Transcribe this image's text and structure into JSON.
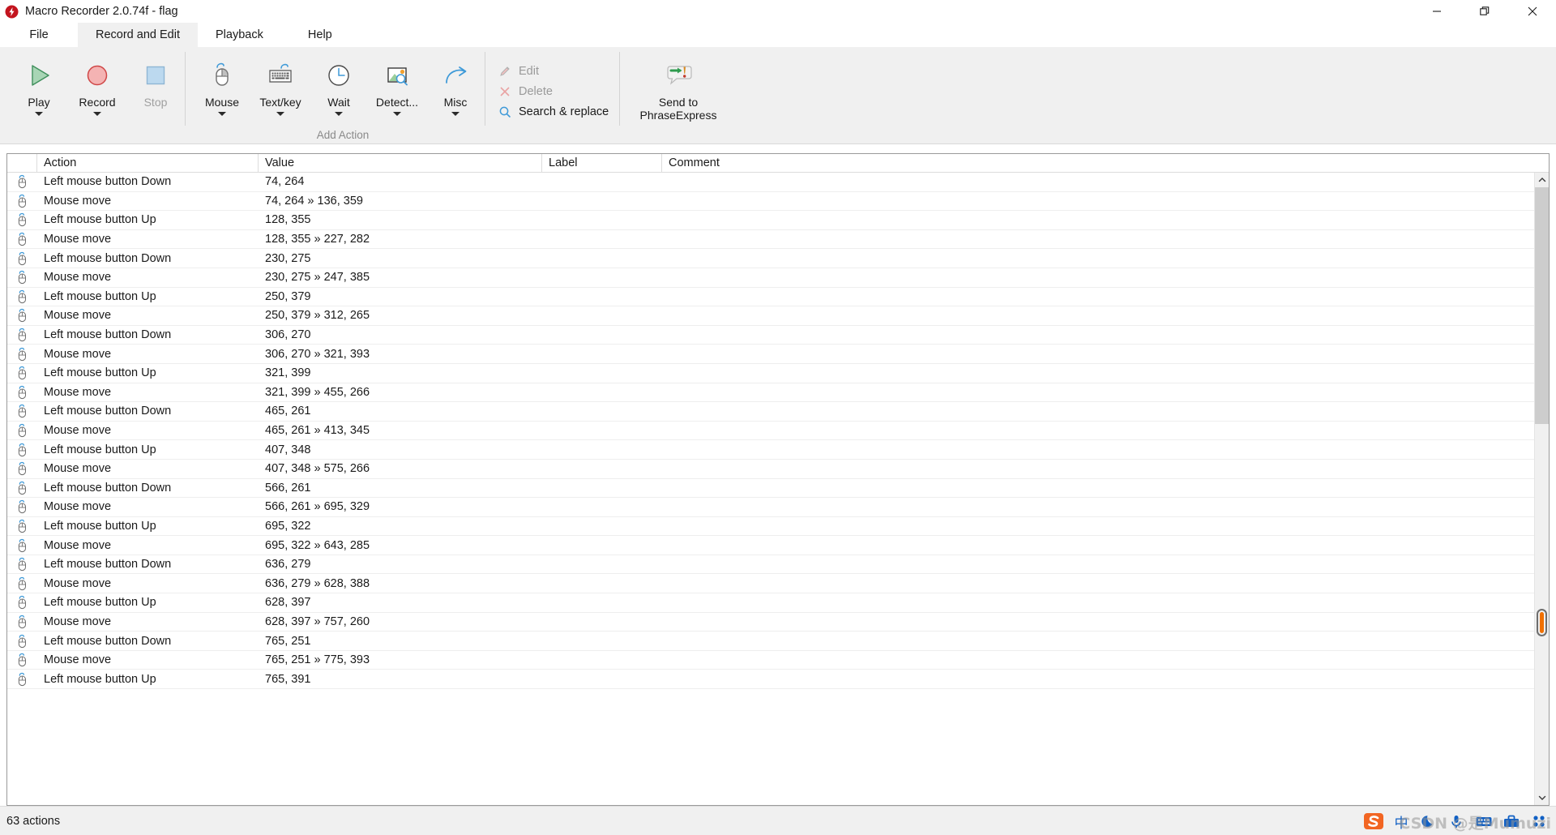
{
  "window": {
    "title": "Macro Recorder 2.0.74f - flag",
    "logo_icon": "lightning-bolt-icon",
    "controls": [
      {
        "name": "minimize-button",
        "icon": "minimize-icon"
      },
      {
        "name": "maximize-button",
        "icon": "restore-icon"
      },
      {
        "name": "close-button",
        "icon": "close-icon"
      }
    ]
  },
  "tabs": [
    {
      "label": "File",
      "active": false
    },
    {
      "label": "Record and Edit",
      "active": true
    },
    {
      "label": "Playback",
      "active": false
    },
    {
      "label": "Help",
      "active": false
    }
  ],
  "ribbon": {
    "group_playback": {
      "buttons": [
        {
          "label": "Play",
          "icon": "play-triangle-icon",
          "caret": true,
          "disabled": false
        },
        {
          "label": "Record",
          "icon": "record-circle-icon",
          "caret": true,
          "disabled": false
        },
        {
          "label": "Stop",
          "icon": "stop-square-icon",
          "caret": false,
          "disabled": true
        }
      ]
    },
    "group_add_action": {
      "title": "Add Action",
      "buttons": [
        {
          "label": "Mouse",
          "icon": "mouse-icon",
          "caret": true,
          "disabled": false
        },
        {
          "label": "Text/key",
          "icon": "keyboard-icon",
          "caret": true,
          "disabled": false
        },
        {
          "label": "Wait",
          "icon": "clock-icon",
          "caret": true,
          "disabled": false
        },
        {
          "label": "Detect...",
          "icon": "image-search-icon",
          "caret": true,
          "disabled": false
        },
        {
          "label": "Misc",
          "icon": "arrow-curve-icon",
          "caret": true,
          "disabled": false
        }
      ]
    },
    "group_edit": {
      "commands": [
        {
          "label": "Edit",
          "icon": "pencil-icon",
          "disabled": true
        },
        {
          "label": "Delete",
          "icon": "x-mark-icon",
          "disabled": true
        },
        {
          "label": "Search & replace",
          "icon": "magnifier-icon",
          "disabled": false
        }
      ]
    },
    "group_send": {
      "buttons": [
        {
          "label": "Send to\nPhraseExpress",
          "label_line1": "Send to",
          "label_line2": "PhraseExpress",
          "icon": "send-phrase-icon",
          "caret": false,
          "disabled": false
        }
      ]
    }
  },
  "table": {
    "columns": [
      {
        "key": "icon",
        "label": ""
      },
      {
        "key": "action",
        "label": "Action"
      },
      {
        "key": "value",
        "label": "Value"
      },
      {
        "key": "label",
        "label": "Label"
      },
      {
        "key": "comment",
        "label": "Comment"
      }
    ],
    "rows": [
      {
        "icon": "mouse-action-icon",
        "action": "Left mouse button Down",
        "value": "74, 264",
        "label": "",
        "comment": ""
      },
      {
        "icon": "mouse-action-icon",
        "action": "Mouse move",
        "value": "74, 264 » 136, 359",
        "label": "",
        "comment": ""
      },
      {
        "icon": "mouse-action-icon",
        "action": "Left mouse button Up",
        "value": "128, 355",
        "label": "",
        "comment": ""
      },
      {
        "icon": "mouse-action-icon",
        "action": "Mouse move",
        "value": "128, 355 » 227, 282",
        "label": "",
        "comment": ""
      },
      {
        "icon": "mouse-action-icon",
        "action": "Left mouse button Down",
        "value": "230, 275",
        "label": "",
        "comment": ""
      },
      {
        "icon": "mouse-action-icon",
        "action": "Mouse move",
        "value": "230, 275 » 247, 385",
        "label": "",
        "comment": ""
      },
      {
        "icon": "mouse-action-icon",
        "action": "Left mouse button Up",
        "value": "250, 379",
        "label": "",
        "comment": ""
      },
      {
        "icon": "mouse-action-icon",
        "action": "Mouse move",
        "value": "250, 379 » 312, 265",
        "label": "",
        "comment": ""
      },
      {
        "icon": "mouse-action-icon",
        "action": "Left mouse button Down",
        "value": "306, 270",
        "label": "",
        "comment": ""
      },
      {
        "icon": "mouse-action-icon",
        "action": "Mouse move",
        "value": "306, 270 » 321, 393",
        "label": "",
        "comment": ""
      },
      {
        "icon": "mouse-action-icon",
        "action": "Left mouse button Up",
        "value": "321, 399",
        "label": "",
        "comment": ""
      },
      {
        "icon": "mouse-action-icon",
        "action": "Mouse move",
        "value": "321, 399 » 455, 266",
        "label": "",
        "comment": ""
      },
      {
        "icon": "mouse-action-icon",
        "action": "Left mouse button Down",
        "value": "465, 261",
        "label": "",
        "comment": ""
      },
      {
        "icon": "mouse-action-icon",
        "action": "Mouse move",
        "value": "465, 261 » 413, 345",
        "label": "",
        "comment": ""
      },
      {
        "icon": "mouse-action-icon",
        "action": "Left mouse button Up",
        "value": "407, 348",
        "label": "",
        "comment": ""
      },
      {
        "icon": "mouse-action-icon",
        "action": "Mouse move",
        "value": "407, 348 » 575, 266",
        "label": "",
        "comment": ""
      },
      {
        "icon": "mouse-action-icon",
        "action": "Left mouse button Down",
        "value": "566, 261",
        "label": "",
        "comment": ""
      },
      {
        "icon": "mouse-action-icon",
        "action": "Mouse move",
        "value": "566, 261 » 695, 329",
        "label": "",
        "comment": ""
      },
      {
        "icon": "mouse-action-icon",
        "action": "Left mouse button Up",
        "value": "695, 322",
        "label": "",
        "comment": ""
      },
      {
        "icon": "mouse-action-icon",
        "action": "Mouse move",
        "value": "695, 322 » 643, 285",
        "label": "",
        "comment": ""
      },
      {
        "icon": "mouse-action-icon",
        "action": "Left mouse button Down",
        "value": "636, 279",
        "label": "",
        "comment": ""
      },
      {
        "icon": "mouse-action-icon",
        "action": "Mouse move",
        "value": "636, 279 » 628, 388",
        "label": "",
        "comment": ""
      },
      {
        "icon": "mouse-action-icon",
        "action": "Left mouse button Up",
        "value": "628, 397",
        "label": "",
        "comment": ""
      },
      {
        "icon": "mouse-action-icon",
        "action": "Mouse move",
        "value": "628, 397 » 757, 260",
        "label": "",
        "comment": ""
      },
      {
        "icon": "mouse-action-icon",
        "action": "Left mouse button Down",
        "value": "765, 251",
        "label": "",
        "comment": ""
      },
      {
        "icon": "mouse-action-icon",
        "action": "Mouse move",
        "value": "765, 251 » 775, 393",
        "label": "",
        "comment": ""
      },
      {
        "icon": "mouse-action-icon",
        "action": "Left mouse button Up",
        "value": "765, 391",
        "label": "",
        "comment": ""
      }
    ]
  },
  "scrollbar": {
    "up_arrow_icon": "chevron-up-icon",
    "down_arrow_icon": "chevron-down-icon",
    "marker_color": "#f07000"
  },
  "statusbar": {
    "text": "63 actions"
  },
  "ime_tray": {
    "items": [
      {
        "name": "sogou-logo-icon",
        "icon": "sogou-s-icon"
      },
      {
        "name": "ime-mode-chinese",
        "icon": "chinese-char-icon",
        "text": "中"
      },
      {
        "name": "ime-moon-icon",
        "icon": "moon-icon"
      },
      {
        "name": "ime-voice-input-icon",
        "icon": "microphone-icon"
      },
      {
        "name": "ime-keyboard-icon",
        "icon": "keyboard-icon"
      },
      {
        "name": "ime-toolbox-icon",
        "icon": "toolbox-icon"
      },
      {
        "name": "ime-menu-icon",
        "icon": "menu-dots-icon"
      }
    ],
    "watermark": "CSDN @是Mumuzi"
  }
}
